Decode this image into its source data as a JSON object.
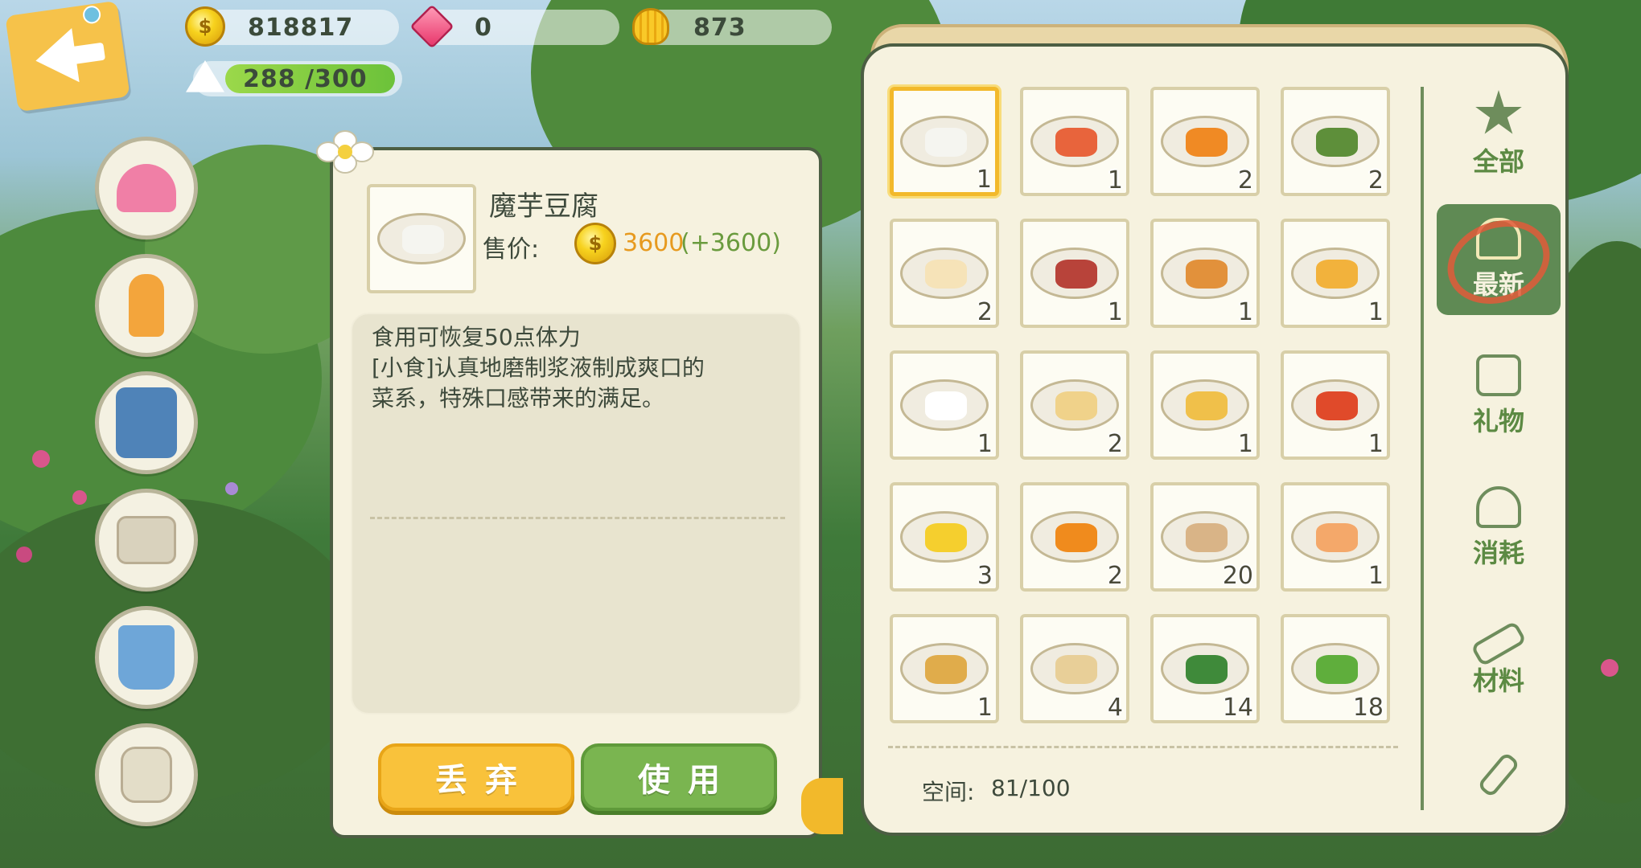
{
  "resources": {
    "gold": "818817",
    "gems": "0",
    "shells": "873",
    "stamina": "288 /300",
    "stamina_fraction": 0.96
  },
  "back_button": {
    "icon": "back-arrow-icon"
  },
  "equipment_slots": [
    {
      "name": "hat-slot",
      "icon": "visor-hat-icon",
      "color": "#f07fa6"
    },
    {
      "name": "accessory-slot",
      "icon": "popsicle-icon",
      "color": "#f3a53c"
    },
    {
      "name": "outfit-slot",
      "icon": "raincoat-icon",
      "color": "#4f83b8"
    },
    {
      "name": "locked-slot",
      "icon": "lock-pants-icon",
      "color": "#b9ad93"
    },
    {
      "name": "shoes-slot",
      "icon": "rain-boots-icon",
      "color": "#6ea6d8"
    },
    {
      "name": "bag-slot",
      "icon": "backpack-icon",
      "color": "#b9ad93"
    }
  ],
  "detail": {
    "item_name": "魔芋豆腐",
    "price_label": "售价:",
    "price_value": "3600",
    "price_bonus": "(+3600)",
    "description": "食用可恢复50点体力\n[小食]认真地磨制浆液制成爽口的\n菜系，特殊口感带来的满足。",
    "discard_label": "丢弃",
    "use_label": "使用"
  },
  "inventory": {
    "space_label": "空间:",
    "space_value": "81/100",
    "items": [
      {
        "name": "konjac-tofu",
        "qty": "1",
        "color": "#f5f5f0",
        "selected": true
      },
      {
        "name": "salad-plate",
        "qty": "1",
        "color": "#e8643c"
      },
      {
        "name": "carrot",
        "qty": "2",
        "color": "#f08a24"
      },
      {
        "name": "asparagus",
        "qty": "2",
        "color": "#5e8f3a"
      },
      {
        "name": "pizza-slice",
        "qty": "2",
        "color": "#f6e3b8"
      },
      {
        "name": "steak-plate",
        "qty": "1",
        "color": "#b8433a"
      },
      {
        "name": "stew-bowl",
        "qty": "1",
        "color": "#e2913b"
      },
      {
        "name": "fried-dish",
        "qty": "1",
        "color": "#f2b23c"
      },
      {
        "name": "mochi-dessert",
        "qty": "1",
        "color": "#ffffff"
      },
      {
        "name": "sandwich-plate",
        "qty": "2",
        "color": "#f0d28a"
      },
      {
        "name": "potato-dish",
        "qty": "1",
        "color": "#f0c04a"
      },
      {
        "name": "tomato-dish",
        "qty": "1",
        "color": "#e04a2a"
      },
      {
        "name": "banana",
        "qty": "3",
        "color": "#f5cf2e"
      },
      {
        "name": "pumpkin",
        "qty": "2",
        "color": "#f08b1d"
      },
      {
        "name": "flour-sack",
        "qty": "20",
        "color": "#d9b487"
      },
      {
        "name": "peach-slice",
        "qty": "1",
        "color": "#f4a86a"
      },
      {
        "name": "wheat",
        "qty": "1",
        "color": "#e0ac4b"
      },
      {
        "name": "seed-bag",
        "qty": "4",
        "color": "#e8cf98"
      },
      {
        "name": "watermelon",
        "qty": "14",
        "color": "#3f8a3a"
      },
      {
        "name": "broccoli",
        "qty": "18",
        "color": "#5fae3c"
      }
    ]
  },
  "tabs": [
    {
      "label": "全部",
      "icon": "star-icon",
      "active": false
    },
    {
      "label": "最新",
      "icon": "bell-icon",
      "active": true
    },
    {
      "label": "礼物",
      "icon": "gift-icon",
      "active": false
    },
    {
      "label": "消耗",
      "icon": "onigiri-icon",
      "active": false
    },
    {
      "label": "材料",
      "icon": "wood-log-icon",
      "active": false
    },
    {
      "label": "",
      "icon": "shovel-icon",
      "active": false
    }
  ],
  "colors": {
    "panel": "#f6f2df",
    "panel_border": "#4c5e43",
    "accent_green": "#7ab550",
    "accent_yellow": "#f9c23b",
    "price_orange": "#e79a1f"
  }
}
